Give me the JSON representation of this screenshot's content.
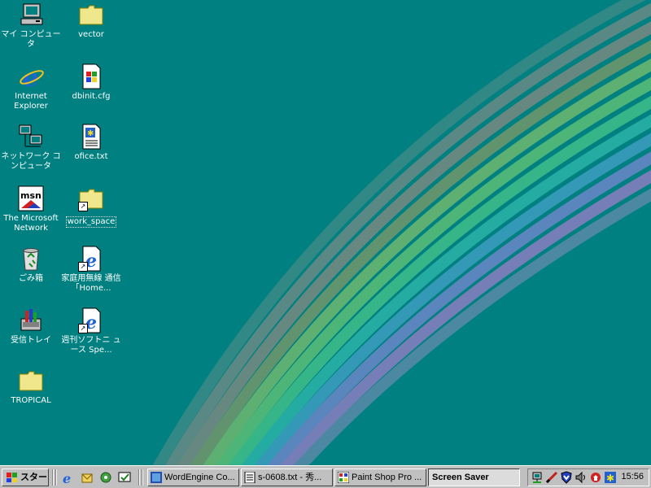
{
  "desktop": {
    "background_color": "#008080",
    "icons": [
      {
        "label": "マイ コンピュータ",
        "icon": "my-computer-icon"
      },
      {
        "label": "vector",
        "icon": "folder-icon"
      },
      {
        "label": "Internet Explorer",
        "icon": "internet-explorer-icon"
      },
      {
        "label": "dbinit.cfg",
        "icon": "windows-file-icon"
      },
      {
        "label": "ネットワーク コンピュータ",
        "icon": "network-computer-icon"
      },
      {
        "label": "ofice.txt",
        "icon": "text-file-icon"
      },
      {
        "label": "The Microsoft Network",
        "icon": "msn-icon"
      },
      {
        "label": "work_space",
        "icon": "folder-shortcut-icon"
      },
      {
        "label": "ごみ箱",
        "icon": "recycle-bin-icon"
      },
      {
        "label": "家庭用無線 通信「Home...",
        "icon": "ie-shortcut-icon"
      },
      {
        "label": "受信トレイ",
        "icon": "inbox-icon"
      },
      {
        "label": "週刊ソフトニ ュース Spe...",
        "icon": "ie-shortcut-icon"
      },
      {
        "label": "TROPICAL",
        "icon": "folder-icon"
      }
    ]
  },
  "taskbar": {
    "start_label": "スタート",
    "quick_launch": [
      "ie-icon",
      "outlook-icon",
      "channel-icon",
      "desktop-icon"
    ],
    "tasks": [
      {
        "label": "WordEngine Co...",
        "icon": "wordengine-icon",
        "active": false
      },
      {
        "label": "s-0608.txt - 秀...",
        "icon": "notepad-icon",
        "active": false
      },
      {
        "label": "Paint Shop Pro ...",
        "icon": "paintshop-icon",
        "active": false
      },
      {
        "label": "Screen Saver",
        "icon": "",
        "active": true
      }
    ],
    "tray_icons": [
      "network-tray-icon",
      "pen-tray-icon",
      "shield-tray-icon",
      "speaker-tray-icon",
      "update-tray-icon",
      "display-tray-icon"
    ],
    "clock": "15:56"
  }
}
